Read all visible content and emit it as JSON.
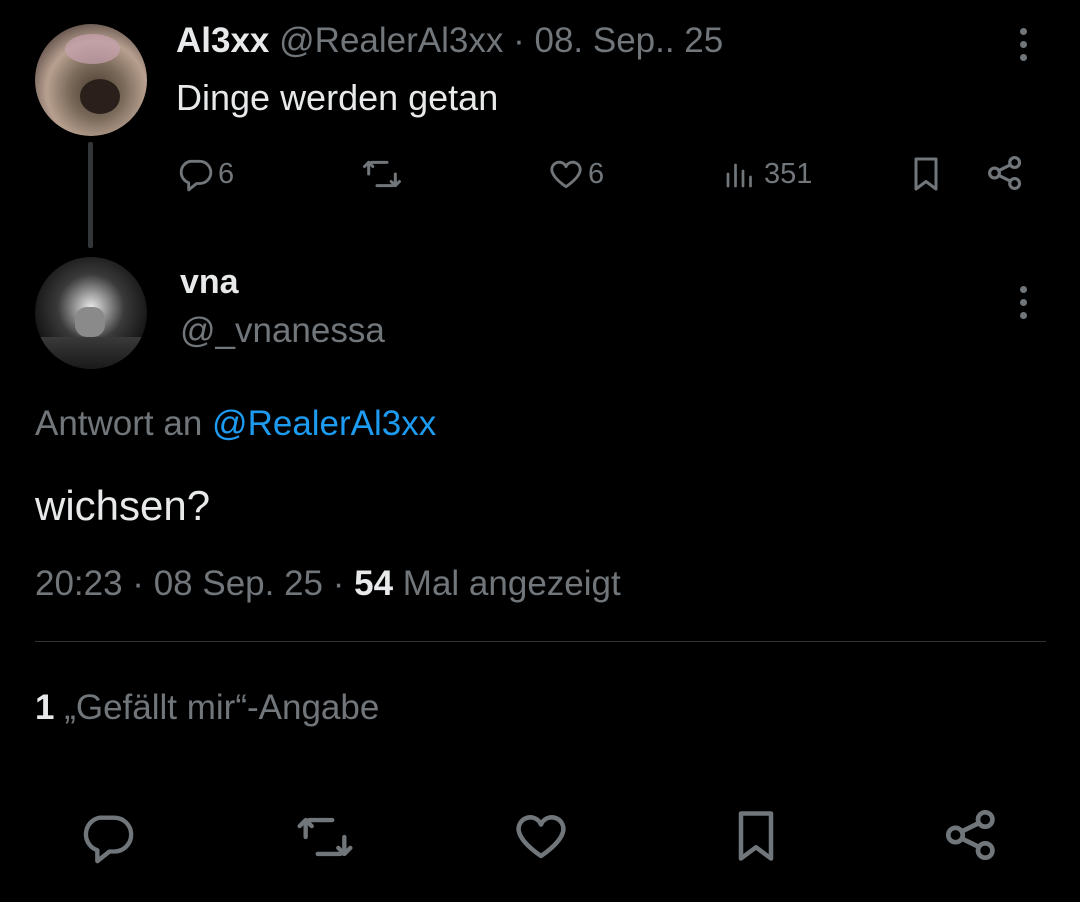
{
  "parent": {
    "name": "Al3xx",
    "handle": "@RealerAl3xx",
    "date": "· 08. Sep.. 25",
    "text": "Dinge werden getan",
    "reply_count": "6",
    "like_count": "6",
    "view_count": "351"
  },
  "reply": {
    "name": "vna",
    "handle": "@_vnanessa",
    "replying_prefix": "Antwort an",
    "replying_to": "@RealerAl3xx",
    "text": "wichsen?",
    "time": "20:23 · 08 Sep. 25 ·",
    "views_count": "54",
    "views_label": "Mal angezeigt",
    "likes_count": "1",
    "likes_label": "„Gefällt mir“-Angabe"
  },
  "colors": {
    "background": "#000000",
    "text": "#e7e9ea",
    "secondary": "#71767b",
    "link": "#1d9bf0",
    "divider": "#2f3336"
  },
  "icons": [
    "reply-icon",
    "retweet-icon",
    "like-icon",
    "views-icon",
    "bookmark-icon",
    "share-icon",
    "more-icon"
  ]
}
